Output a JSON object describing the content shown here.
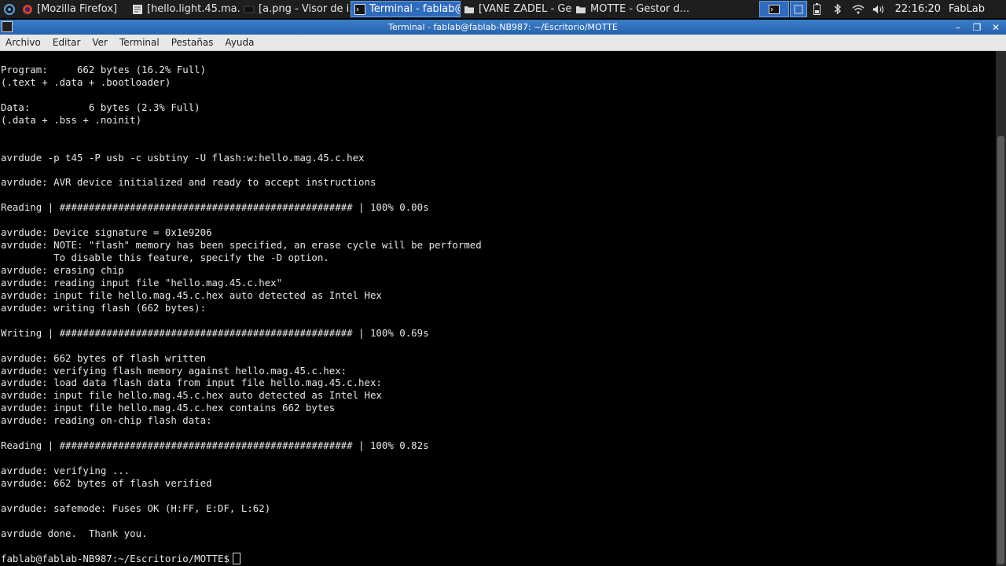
{
  "taskbar": {
    "tasks": [
      {
        "label": "[Mozilla Firefox]",
        "icon": "firefox-icon",
        "active": false
      },
      {
        "label": "[hello.light.45.ma...",
        "icon": "text-editor-icon",
        "active": false
      },
      {
        "label": "[a.png - Visor de i...",
        "icon": "image-viewer-icon",
        "active": false
      },
      {
        "label": "Terminal - fablab@...",
        "icon": "terminal-icon",
        "active": true
      },
      {
        "label": "[VANE ZADEL - Ges...",
        "icon": "folder-icon",
        "active": false
      },
      {
        "label": "MOTTE - Gestor d...",
        "icon": "folder-icon",
        "active": false
      }
    ],
    "clock": "22:16:20",
    "user": "FabLab"
  },
  "window": {
    "title": "Terminal - fablab@fablab-NB987: ~/Escritorio/MOTTE"
  },
  "menubar": {
    "items": [
      "Archivo",
      "Editar",
      "Ver",
      "Terminal",
      "Pestañas",
      "Ayuda"
    ]
  },
  "terminal": {
    "lines": [
      "Program:     662 bytes (16.2% Full)",
      "(.text + .data + .bootloader)",
      "",
      "Data:          6 bytes (2.3% Full)",
      "(.data + .bss + .noinit)",
      "",
      "",
      "avrdude -p t45 -P usb -c usbtiny -U flash:w:hello.mag.45.c.hex",
      "",
      "avrdude: AVR device initialized and ready to accept instructions",
      "",
      "Reading | ################################################## | 100% 0.00s",
      "",
      "avrdude: Device signature = 0x1e9206",
      "avrdude: NOTE: \"flash\" memory has been specified, an erase cycle will be performed",
      "         To disable this feature, specify the -D option.",
      "avrdude: erasing chip",
      "avrdude: reading input file \"hello.mag.45.c.hex\"",
      "avrdude: input file hello.mag.45.c.hex auto detected as Intel Hex",
      "avrdude: writing flash (662 bytes):",
      "",
      "Writing | ################################################## | 100% 0.69s",
      "",
      "avrdude: 662 bytes of flash written",
      "avrdude: verifying flash memory against hello.mag.45.c.hex:",
      "avrdude: load data flash data from input file hello.mag.45.c.hex:",
      "avrdude: input file hello.mag.45.c.hex auto detected as Intel Hex",
      "avrdude: input file hello.mag.45.c.hex contains 662 bytes",
      "avrdude: reading on-chip flash data:",
      "",
      "Reading | ################################################## | 100% 0.82s",
      "",
      "avrdude: verifying ...",
      "avrdude: 662 bytes of flash verified",
      "",
      "avrdude: safemode: Fuses OK (H:FF, E:DF, L:62)",
      "",
      "avrdude done.  Thank you.",
      ""
    ],
    "prompt": "fablab@fablab-NB987:~/Escritorio/MOTTE$"
  },
  "colors": {
    "terminal_bg": "#000000",
    "terminal_fg": "#e6e6e6",
    "titlebar": "#2f6bbd",
    "taskbar_bg": "#1e1e1e"
  }
}
